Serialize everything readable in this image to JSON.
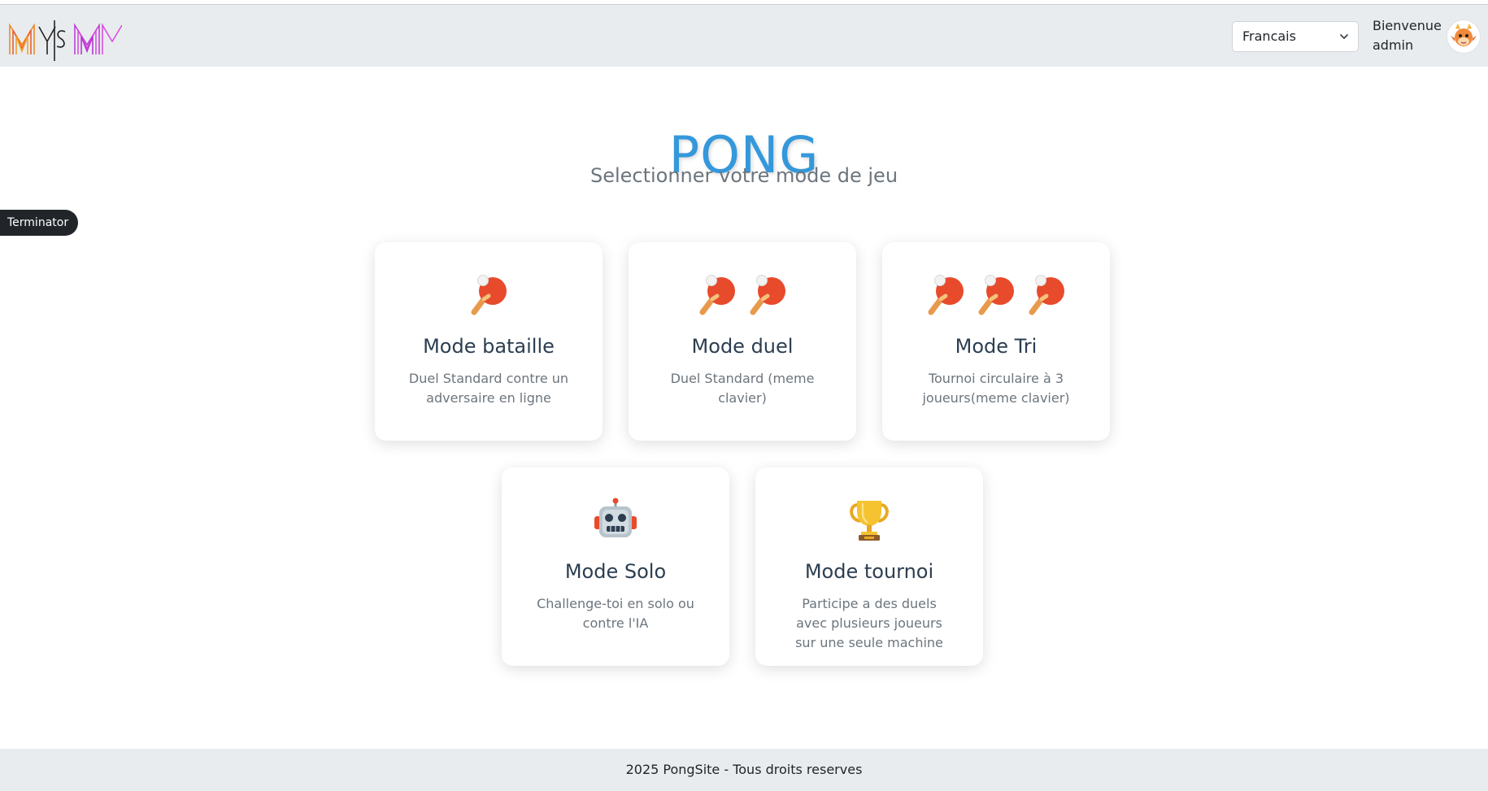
{
  "header": {
    "logo_text": "MYSM",
    "language": {
      "selected": "Francais"
    },
    "welcome_line1": "Bienvenue",
    "welcome_line2": "admin",
    "avatar_icon": "dragon-avatar-icon"
  },
  "main": {
    "title": "PONG",
    "subtitle": "Selectionner votre mode de jeu",
    "terminator_label": "Terminator",
    "modes": [
      {
        "title": "Mode bataille",
        "description": "Duel Standard contre un adversaire en ligne",
        "icon": "ping-pong-icon",
        "icon_count": 1
      },
      {
        "title": "Mode duel",
        "description": "Duel Standard (meme clavier)",
        "icon": "ping-pong-icon",
        "icon_count": 2
      },
      {
        "title": "Mode Tri",
        "description": "Tournoi circulaire à 3 joueurs(meme clavier)",
        "icon": "ping-pong-icon",
        "icon_count": 3
      },
      {
        "title": "Mode Solo",
        "description": "Challenge-toi en solo ou contre l'IA",
        "icon": "robot-icon",
        "icon_count": 1
      },
      {
        "title": "Mode tournoi",
        "description": "Participe a des duels avec plusieurs joueurs sur une seule machine",
        "icon": "trophy-icon",
        "icon_count": 1
      }
    ]
  },
  "footer": {
    "text": "2025 PongSite - Tous droits reserves"
  },
  "colors": {
    "accent": "#3498db",
    "navbar_bg": "#e9ecef",
    "card_title": "#2c3e50",
    "muted_text": "#6c757d"
  }
}
